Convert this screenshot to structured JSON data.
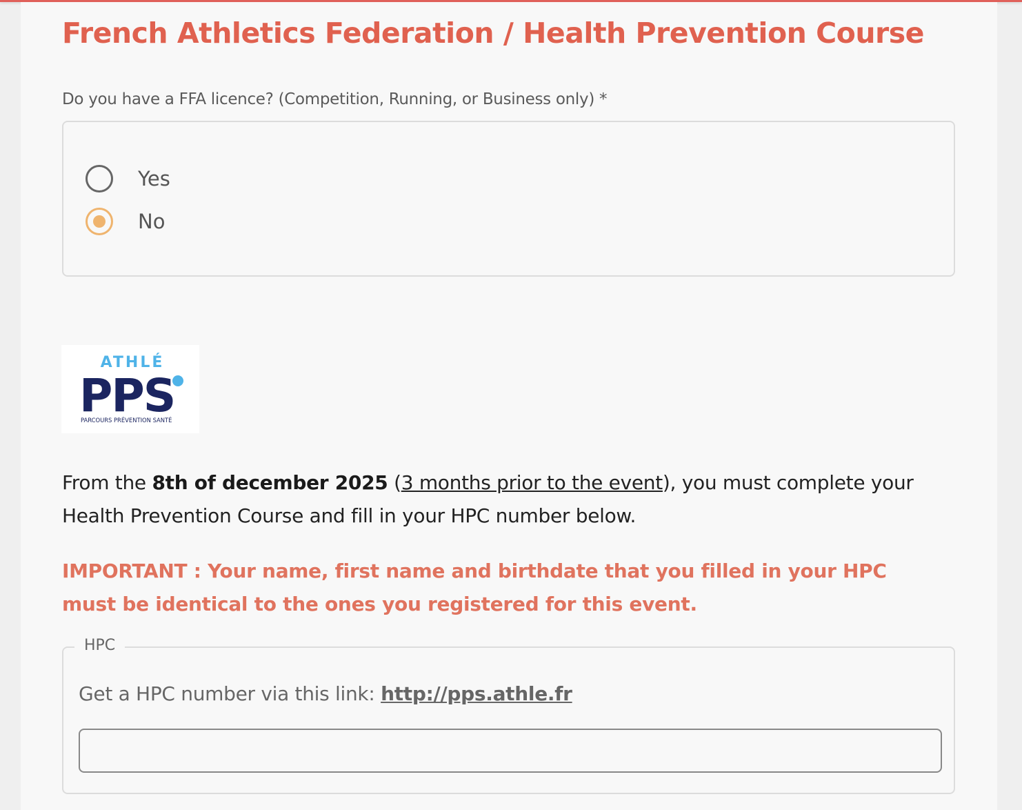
{
  "header": {
    "title": "French Athletics Federation  / Health Prevention Course"
  },
  "licence_question": {
    "label": "Do you have a FFA licence? (Competition, Running, or Business only) *",
    "options": [
      {
        "label": "Yes",
        "checked": false
      },
      {
        "label": "No",
        "checked": true
      }
    ]
  },
  "logo": {
    "top_text": "ATHLÉ",
    "main_text": "PPS",
    "sub_text": "PARCOURS PRÉVENTION SANTÉ",
    "colors": {
      "light_blue": "#4fb3e8",
      "navy": "#1b2560"
    }
  },
  "intro": {
    "prefix": "From the ",
    "date": "8th of december 2025",
    "open_paren": " (",
    "link_text": "3 months prior to the event",
    "suffix": "), you must complete your Health Prevention Course and fill in your HPC number below."
  },
  "important_text": "IMPORTANT : Your name, first name and birthdate that you filled in your HPC must be identical to the ones you registered for this event.",
  "hpc": {
    "legend": "HPC",
    "hint_prefix": "Get a HPC number via this link: ",
    "link": "http://pps.athle.fr",
    "input_value": "",
    "input_placeholder": ""
  },
  "colors": {
    "title": "#e0614f",
    "important": "#e0735e",
    "radio_selected": "#efb46e",
    "top_bar": "#e0605a"
  }
}
